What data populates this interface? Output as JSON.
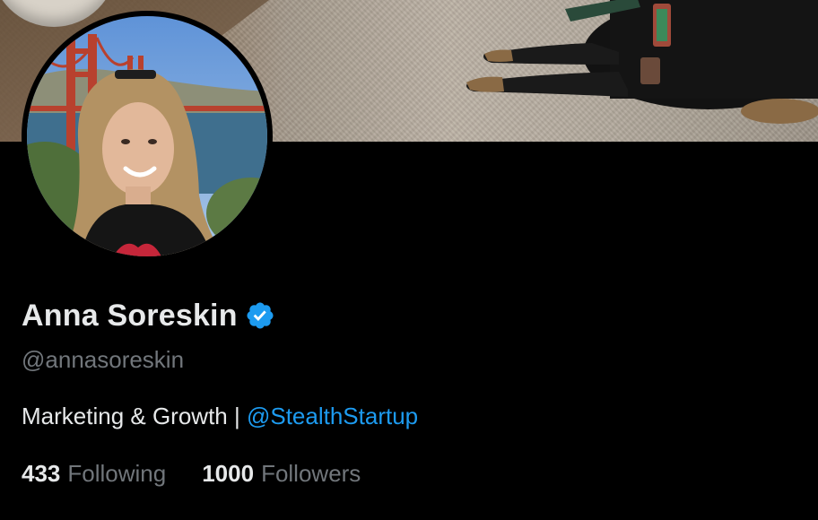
{
  "profile": {
    "display_name": "Anna Soreskin",
    "verified_icon": "verified-badge-icon",
    "handle": "@annasoreskin",
    "bio_text": "Marketing & Growth | ",
    "bio_link": "@StealthStartup"
  },
  "stats": {
    "following_count": "433",
    "following_label": "Following",
    "followers_count": "1000",
    "followers_label": "Followers"
  },
  "colors": {
    "background": "#000000",
    "primary_text": "#e7e9ea",
    "secondary_text": "#71767b",
    "link": "#1d9bf0",
    "verified": "#1d9bf0"
  }
}
